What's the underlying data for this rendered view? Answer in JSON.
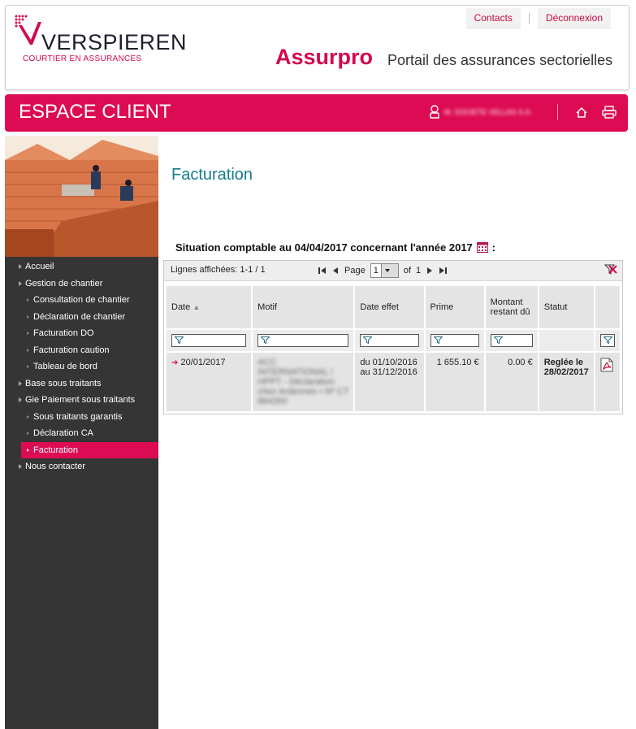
{
  "header": {
    "logo_text": "VERSPIEREN",
    "logo_sub": "COURTIER EN ASSURANCES",
    "links": [
      "Contacts",
      "Déconnexion"
    ],
    "brand": "Assurpro",
    "tagline": "Portail des assurances sectorielles"
  },
  "bar": {
    "title": "ESPACE CLIENT",
    "user_name": "M. SOCIETE VELLAS S.A."
  },
  "sidebar": {
    "items": [
      {
        "label": "Accueil",
        "level": 1
      },
      {
        "label": "Gestion de chantier",
        "level": 1
      },
      {
        "label": "Consultation de chantier",
        "level": 2
      },
      {
        "label": "Déclaration de chantier",
        "level": 2
      },
      {
        "label": "Facturation DO",
        "level": 2
      },
      {
        "label": "Facturation caution",
        "level": 2
      },
      {
        "label": "Tableau de bord",
        "level": 2
      },
      {
        "label": "Base sous traitants",
        "level": 1
      },
      {
        "label": "Gie Paiement sous traitants",
        "level": 1
      },
      {
        "label": "Sous traitants garantis",
        "level": 2
      },
      {
        "label": "Déclaration CA",
        "level": 2
      },
      {
        "label": "Facturation",
        "level": 2,
        "active": true
      },
      {
        "label": "Nous contacter",
        "level": 1
      }
    ]
  },
  "main": {
    "title": "Facturation",
    "situation": "Situation comptable au 04/04/2017  concernant l'année 2017",
    "situation_suffix": ":"
  },
  "grid": {
    "lines_label": "Lignes affichées: 1-1 / 1",
    "page_label": "Page",
    "page_value": "1",
    "of_label": "of",
    "total_pages": "1",
    "columns": [
      "Date",
      "Motif",
      "Date effet",
      "Prime",
      "Montant restant dû",
      "Statut"
    ],
    "rows": [
      {
        "date": "20/01/2017",
        "motif": "ACC INTERNATIONAL / HPPT - Déclaration chez Ardennes • Nº CT 884350",
        "date_effet": "du 01/10/2016 au 31/12/2016",
        "prime": "1 655.10 €",
        "montant": "0.00 €",
        "statut_line1": "Reglée le",
        "statut_line2": "28/02/2017"
      }
    ]
  },
  "colors": {
    "accent": "#dd0b53",
    "title_teal": "#167c8e",
    "sidebar_bg": "#353535"
  }
}
